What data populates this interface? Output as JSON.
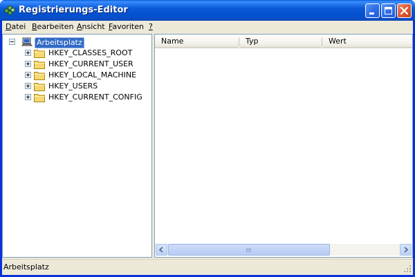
{
  "window": {
    "title": "Registrierungs-Editor"
  },
  "menu": [
    {
      "pre": "",
      "u": "D",
      "post": "atei"
    },
    {
      "pre": "",
      "u": "B",
      "post": "earbeiten"
    },
    {
      "pre": "",
      "u": "A",
      "post": "nsicht"
    },
    {
      "pre": "",
      "u": "F",
      "post": "avoriten"
    },
    {
      "pre": "",
      "u": "?",
      "post": ""
    }
  ],
  "tree": {
    "root": "Arbeitsplatz",
    "keys": [
      "HKEY_CLASSES_ROOT",
      "HKEY_CURRENT_USER",
      "HKEY_LOCAL_MACHINE",
      "HKEY_USERS",
      "HKEY_CURRENT_CONFIG"
    ]
  },
  "list": {
    "columns": [
      "Name",
      "Typ",
      "Wert"
    ]
  },
  "statusbar": {
    "text": "Arbeitsplatz"
  },
  "icons": {
    "app": "registry-editor-icon",
    "computer": "computer-icon",
    "folder": "folder-icon"
  },
  "colors": {
    "titlebar": "#0a5ad6",
    "selection": "#316ac5",
    "close_button": "#de5a32"
  }
}
